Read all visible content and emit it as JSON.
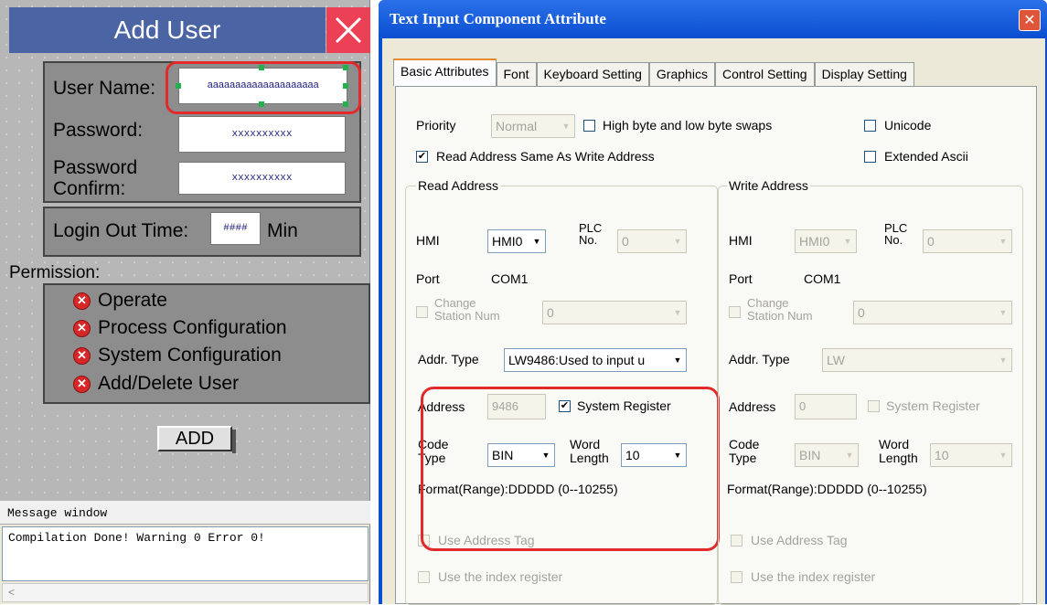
{
  "hmi": {
    "title": "Add User",
    "user_name_label": "User Name:",
    "user_name_value": "aaaaaaaaaaaaaaaaaaaa",
    "password_label": "Password:",
    "password_value": "xxxxxxxxxx",
    "password_confirm_label_1": "Password",
    "password_confirm_label_2": "Confirm:",
    "password_confirm_value": "xxxxxxxxxx",
    "login_out_time_label": "Login Out Time:",
    "login_out_time_value": "####",
    "login_out_time_unit": "Min",
    "permission_label": "Permission:",
    "permissions": [
      "Operate",
      "Process Configuration",
      "System Configuration",
      "Add/Delete User"
    ],
    "add_button": "ADD"
  },
  "message_window": {
    "title": "Message window",
    "text": "Compilation Done! Warning 0 Error 0!",
    "scroll_left": "<"
  },
  "dialog": {
    "title": "Text Input Component Attribute",
    "close": "✕",
    "tabs": [
      "Basic Attributes",
      "Font",
      "Keyboard Setting",
      "Graphics",
      "Control Setting",
      "Display Setting"
    ],
    "priority_label": "Priority",
    "priority_value": "Normal",
    "byte_swap_label": "High byte and low byte swaps",
    "unicode_label": "Unicode",
    "read_same_label": "Read Address Same As Write Address",
    "extended_ascii_label": "Extended Ascii",
    "read": {
      "group_title": "Read Address",
      "hmi_label": "HMI",
      "hmi_value": "HMI0",
      "plc_label_1": "PLC",
      "plc_label_2": "No.",
      "plc_value": "0",
      "port_label": "Port",
      "port_value": "COM1",
      "change_label_1": "Change",
      "change_label_2": "Station Num",
      "change_value": "0",
      "addr_type_label": "Addr. Type",
      "addr_type_value": "LW9486:Used to input u",
      "address_label": "Address",
      "address_value": "9486",
      "system_register_label": "System Register",
      "code_type_label_1": "Code",
      "code_type_label_2": "Type",
      "code_type_value": "BIN",
      "word_length_label_1": "Word",
      "word_length_label_2": "Length",
      "word_length_value": "10",
      "format": "Format(Range):DDDDD (0--10255)",
      "use_tag_label": "Use Address Tag",
      "use_index_label": "Use the index register"
    },
    "write": {
      "group_title": "Write Address",
      "hmi_label": "HMI",
      "hmi_value": "HMI0",
      "plc_label_1": "PLC",
      "plc_label_2": "No.",
      "plc_value": "0",
      "port_label": "Port",
      "port_value": "COM1",
      "change_label_1": "Change",
      "change_label_2": "Station Num",
      "change_value": "0",
      "addr_type_label": "Addr. Type",
      "addr_type_value": "LW",
      "address_label": "Address",
      "address_value": "0",
      "system_register_label": "System Register",
      "code_type_label_1": "Code",
      "code_type_label_2": "Type",
      "code_type_value": "BIN",
      "word_length_label_1": "Word",
      "word_length_label_2": "Length",
      "word_length_value": "10",
      "format": "Format(Range):DDDDD (0--10255)",
      "use_tag_label": "Use Address Tag",
      "use_index_label": "Use the index register"
    }
  },
  "colors": {
    "title_bar": "#4a64a4",
    "close": "#ec4056",
    "highlight": "#e12b2b",
    "dialog_title": "#0b4fd1"
  }
}
